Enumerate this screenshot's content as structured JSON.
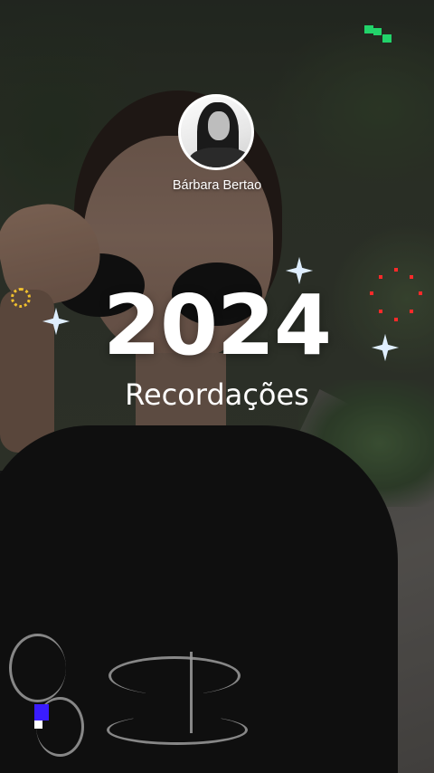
{
  "profile": {
    "name": "Bárbara Bertao",
    "avatar_icon": "profile-photo"
  },
  "story": {
    "year": "2024",
    "subtitle": "Recordações"
  },
  "colors": {
    "text": "#ffffff",
    "sparkle": "#dfeefe",
    "gold_dots": "#f0c02e",
    "red_dots": "#ff2a2a",
    "green_pixels": "#22d36a",
    "blue_pixel": "#3a1cff"
  }
}
